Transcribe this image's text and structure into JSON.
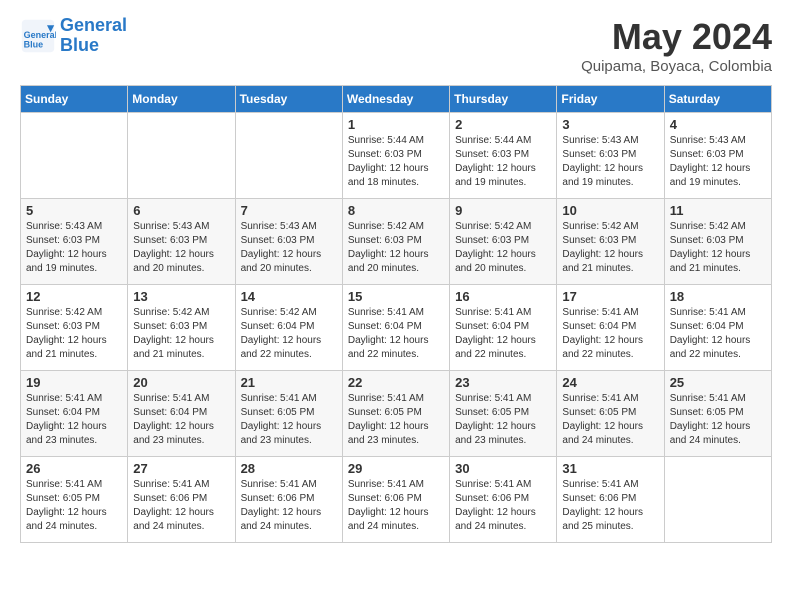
{
  "logo": {
    "line1": "General",
    "line2": "Blue"
  },
  "title": "May 2024",
  "location": "Quipama, Boyaca, Colombia",
  "header": {
    "days": [
      "Sunday",
      "Monday",
      "Tuesday",
      "Wednesday",
      "Thursday",
      "Friday",
      "Saturday"
    ]
  },
  "weeks": [
    {
      "cells": [
        {
          "empty": true
        },
        {
          "empty": true
        },
        {
          "empty": true
        },
        {
          "day": "1",
          "sunrise": "5:44 AM",
          "sunset": "6:03 PM",
          "daylight": "12 hours and 18 minutes."
        },
        {
          "day": "2",
          "sunrise": "5:44 AM",
          "sunset": "6:03 PM",
          "daylight": "12 hours and 19 minutes."
        },
        {
          "day": "3",
          "sunrise": "5:43 AM",
          "sunset": "6:03 PM",
          "daylight": "12 hours and 19 minutes."
        },
        {
          "day": "4",
          "sunrise": "5:43 AM",
          "sunset": "6:03 PM",
          "daylight": "12 hours and 19 minutes."
        }
      ]
    },
    {
      "cells": [
        {
          "day": "5",
          "sunrise": "5:43 AM",
          "sunset": "6:03 PM",
          "daylight": "12 hours and 19 minutes."
        },
        {
          "day": "6",
          "sunrise": "5:43 AM",
          "sunset": "6:03 PM",
          "daylight": "12 hours and 20 minutes."
        },
        {
          "day": "7",
          "sunrise": "5:43 AM",
          "sunset": "6:03 PM",
          "daylight": "12 hours and 20 minutes."
        },
        {
          "day": "8",
          "sunrise": "5:42 AM",
          "sunset": "6:03 PM",
          "daylight": "12 hours and 20 minutes."
        },
        {
          "day": "9",
          "sunrise": "5:42 AM",
          "sunset": "6:03 PM",
          "daylight": "12 hours and 20 minutes."
        },
        {
          "day": "10",
          "sunrise": "5:42 AM",
          "sunset": "6:03 PM",
          "daylight": "12 hours and 21 minutes."
        },
        {
          "day": "11",
          "sunrise": "5:42 AM",
          "sunset": "6:03 PM",
          "daylight": "12 hours and 21 minutes."
        }
      ]
    },
    {
      "cells": [
        {
          "day": "12",
          "sunrise": "5:42 AM",
          "sunset": "6:03 PM",
          "daylight": "12 hours and 21 minutes."
        },
        {
          "day": "13",
          "sunrise": "5:42 AM",
          "sunset": "6:03 PM",
          "daylight": "12 hours and 21 minutes."
        },
        {
          "day": "14",
          "sunrise": "5:42 AM",
          "sunset": "6:04 PM",
          "daylight": "12 hours and 22 minutes."
        },
        {
          "day": "15",
          "sunrise": "5:41 AM",
          "sunset": "6:04 PM",
          "daylight": "12 hours and 22 minutes."
        },
        {
          "day": "16",
          "sunrise": "5:41 AM",
          "sunset": "6:04 PM",
          "daylight": "12 hours and 22 minutes."
        },
        {
          "day": "17",
          "sunrise": "5:41 AM",
          "sunset": "6:04 PM",
          "daylight": "12 hours and 22 minutes."
        },
        {
          "day": "18",
          "sunrise": "5:41 AM",
          "sunset": "6:04 PM",
          "daylight": "12 hours and 22 minutes."
        }
      ]
    },
    {
      "cells": [
        {
          "day": "19",
          "sunrise": "5:41 AM",
          "sunset": "6:04 PM",
          "daylight": "12 hours and 23 minutes."
        },
        {
          "day": "20",
          "sunrise": "5:41 AM",
          "sunset": "6:04 PM",
          "daylight": "12 hours and 23 minutes."
        },
        {
          "day": "21",
          "sunrise": "5:41 AM",
          "sunset": "6:05 PM",
          "daylight": "12 hours and 23 minutes."
        },
        {
          "day": "22",
          "sunrise": "5:41 AM",
          "sunset": "6:05 PM",
          "daylight": "12 hours and 23 minutes."
        },
        {
          "day": "23",
          "sunrise": "5:41 AM",
          "sunset": "6:05 PM",
          "daylight": "12 hours and 23 minutes."
        },
        {
          "day": "24",
          "sunrise": "5:41 AM",
          "sunset": "6:05 PM",
          "daylight": "12 hours and 24 minutes."
        },
        {
          "day": "25",
          "sunrise": "5:41 AM",
          "sunset": "6:05 PM",
          "daylight": "12 hours and 24 minutes."
        }
      ]
    },
    {
      "cells": [
        {
          "day": "26",
          "sunrise": "5:41 AM",
          "sunset": "6:05 PM",
          "daylight": "12 hours and 24 minutes."
        },
        {
          "day": "27",
          "sunrise": "5:41 AM",
          "sunset": "6:06 PM",
          "daylight": "12 hours and 24 minutes."
        },
        {
          "day": "28",
          "sunrise": "5:41 AM",
          "sunset": "6:06 PM",
          "daylight": "12 hours and 24 minutes."
        },
        {
          "day": "29",
          "sunrise": "5:41 AM",
          "sunset": "6:06 PM",
          "daylight": "12 hours and 24 minutes."
        },
        {
          "day": "30",
          "sunrise": "5:41 AM",
          "sunset": "6:06 PM",
          "daylight": "12 hours and 24 minutes."
        },
        {
          "day": "31",
          "sunrise": "5:41 AM",
          "sunset": "6:06 PM",
          "daylight": "12 hours and 25 minutes."
        },
        {
          "empty": true
        }
      ]
    }
  ]
}
